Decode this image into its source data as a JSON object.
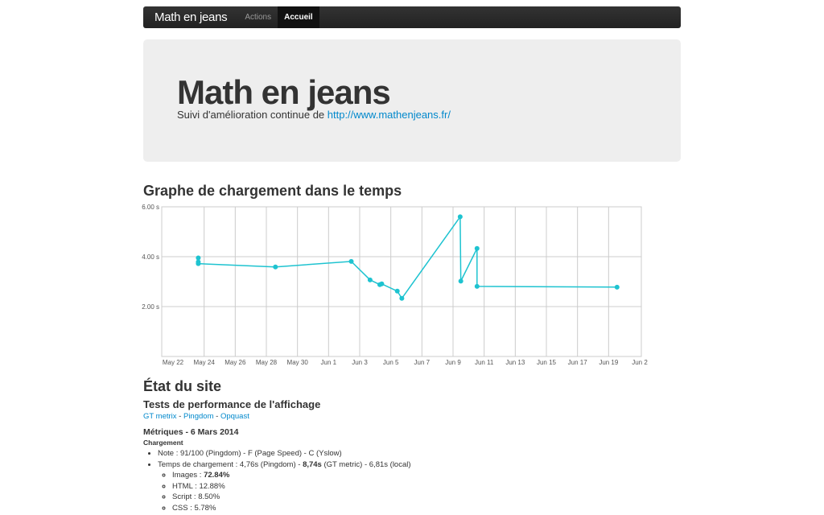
{
  "navbar": {
    "brand": "Math en jeans",
    "items": [
      {
        "label": "Actions",
        "active": false
      },
      {
        "label": "Accueil",
        "active": true
      }
    ]
  },
  "hero": {
    "title": "Math en jeans",
    "subtitle_prefix": "Suivi d'amélioration continue de ",
    "link": "http://www.mathenjeans.fr/"
  },
  "chart_section": {
    "title": "Graphe de chargement dans le temps"
  },
  "chart_data": {
    "type": "line",
    "title": "",
    "xlabel": "",
    "ylabel": "",
    "x_ticks": [
      "May 22",
      "May 24",
      "May 26",
      "May 28",
      "May 30",
      "Jun 1",
      "Jun 3",
      "Jun 5",
      "Jun 7",
      "Jun 9",
      "Jun 11",
      "Jun 13",
      "Jun 15",
      "Jun 17",
      "Jun 19",
      "Jun 2"
    ],
    "y_ticks": [
      "6.00 s",
      "4.00 s",
      "2.00 s"
    ],
    "ylim": [
      0,
      6
    ],
    "xlim": [
      "05-22 00:00",
      "06-21 00:00"
    ],
    "grid": true,
    "color": "#1ec3d0",
    "points": [
      {
        "x": "05-23 15:00",
        "y": 3.95
      },
      {
        "x": "05-23 15:00",
        "y": 3.79
      },
      {
        "x": "05-23 15:00",
        "y": 3.72
      },
      {
        "x": "05-28 14:00",
        "y": 3.59
      },
      {
        "x": "06-02 11:00",
        "y": 3.81
      },
      {
        "x": "06-03 16:00",
        "y": 3.07
      },
      {
        "x": "06-04 07:00",
        "y": 2.88
      },
      {
        "x": "06-04 10:00",
        "y": 2.91
      },
      {
        "x": "06-05 10:00",
        "y": 2.62
      },
      {
        "x": "06-05 17:00",
        "y": 2.33
      },
      {
        "x": "06-09 11:00",
        "y": 5.6
      },
      {
        "x": "06-09 12:00",
        "y": 3.02
      },
      {
        "x": "06-10 13:00",
        "y": 4.33
      },
      {
        "x": "06-10 13:00",
        "y": 2.81
      },
      {
        "x": "06-19 13:00",
        "y": 2.78
      }
    ]
  },
  "status": {
    "title": "État du site",
    "perf_title": "Tests de performance de l'affichage",
    "links": [
      "GT metrix",
      "Pingdom",
      "Opquast"
    ],
    "link_sep": " - ",
    "metrics_title": "Métriques - 6 Mars 2014",
    "loading_title": "Chargement",
    "note": "Note : 91/100 (Pingdom) - F (Page Speed) - C (Yslow)",
    "time_prefix": "Temps de chargement : 4,76s (Pingdom) - ",
    "time_bold": "8,74s",
    "time_suffix": " (GT metric) - 6,81s (local)",
    "breakdown": [
      {
        "label": "Images : ",
        "value": "72.84%",
        "bold": true
      },
      {
        "label": "HTML : ",
        "value": "12.88%"
      },
      {
        "label": "Script : ",
        "value": "8.50%"
      },
      {
        "label": "CSS : ",
        "value": "5.78%"
      }
    ]
  }
}
